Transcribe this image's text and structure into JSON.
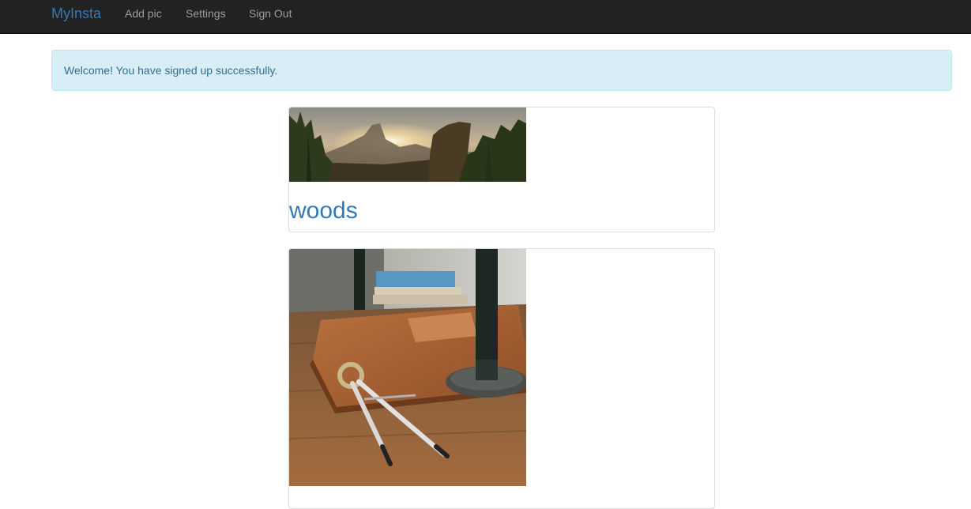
{
  "navbar": {
    "brand": "MyInsta",
    "links": [
      "Add pic",
      "Settings",
      "Sign Out"
    ]
  },
  "flash": {
    "message": "Welcome! You have signed up successfully."
  },
  "posts": [
    {
      "caption": "woods"
    },
    {
      "caption": ""
    }
  ],
  "colors": {
    "navbar_bg": "#222222",
    "brand": "#337ab7",
    "nav_link": "#9d9d9d",
    "alert_bg": "#d9edf7",
    "alert_text": "#31708f",
    "caption": "#337ab7"
  }
}
